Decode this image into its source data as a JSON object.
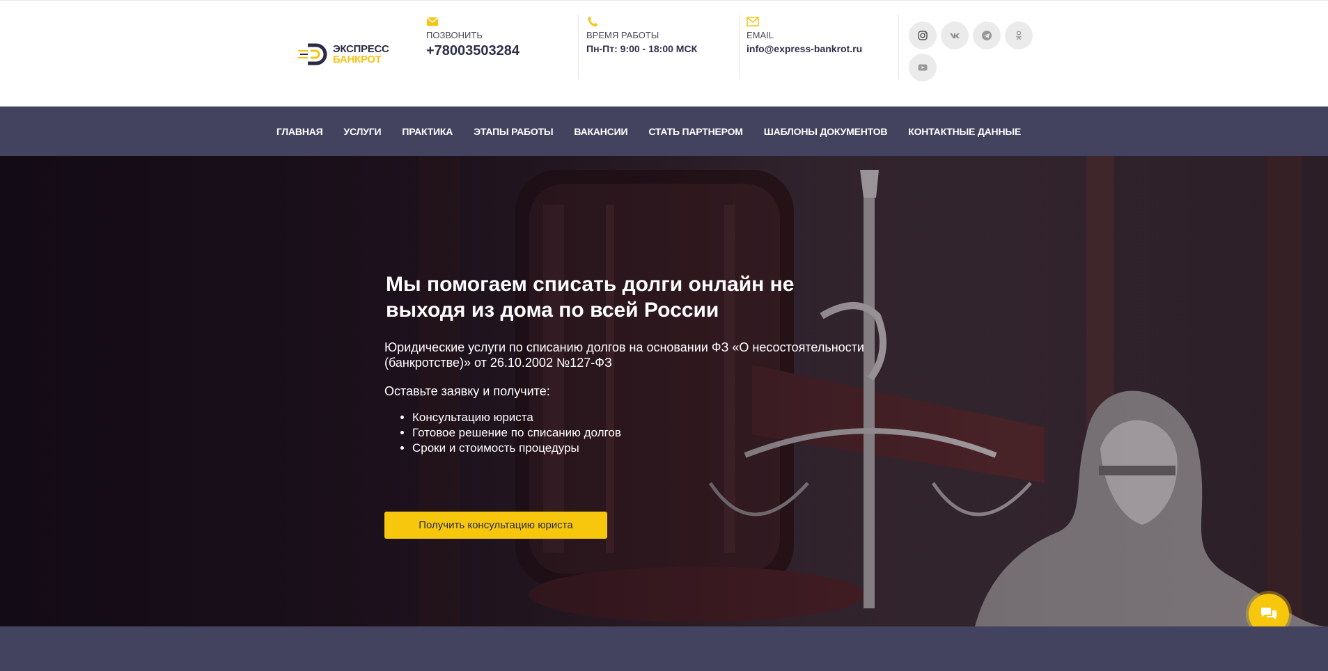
{
  "brand": {
    "line1": "ЭКСПРЕСС",
    "line2": "БАНКРОТ"
  },
  "contacts": {
    "phone": {
      "caption": "ПОЗВОНИТЬ",
      "value": "+78003503284",
      "icon": "envelope-icon"
    },
    "hours": {
      "caption": "ВРЕМЯ РАБОТЫ",
      "value": "Пн-Пт: 9:00 - 18:00 МСК",
      "icon": "phone-icon"
    },
    "email": {
      "caption": "EMAIL",
      "value": "info@express-bankrot.ru",
      "icon": "envelope-icon"
    }
  },
  "socials": [
    "instagram-icon",
    "vk-icon",
    "telegram-icon",
    "odnoklassniki-icon",
    "youtube-icon"
  ],
  "nav": {
    "items": [
      "ГЛАВНАЯ",
      "УСЛУГИ",
      "ПРАКТИКА",
      "ЭТАПЫ РАБОТЫ",
      "ВАКАНСИИ",
      "СТАТЬ ПАРТНЕРОМ",
      "ШАБЛОНЫ ДОКУМЕНТОВ",
      "КОНТАКТНЫЕ ДАННЫЕ"
    ]
  },
  "hero": {
    "title": "Мы помогаем списать долги онлайн не выходя из дома по всей России",
    "subtitle": "Юридические услуги по списанию долгов на основании ФЗ «О несостоятельности (банкротстве)» от 26.10.2002 №127-ФЗ",
    "lead": "Оставьте заявку и получите:",
    "bullets": [
      "Консультацию юриста",
      "Готовое решение по списанию долгов",
      "Сроки и стоимость процедуры"
    ],
    "cta": "Получить консультацию юриста"
  },
  "colors": {
    "accent": "#f7c70d",
    "nav_bg": "#44435f",
    "brand_dark": "#2b2b45"
  }
}
